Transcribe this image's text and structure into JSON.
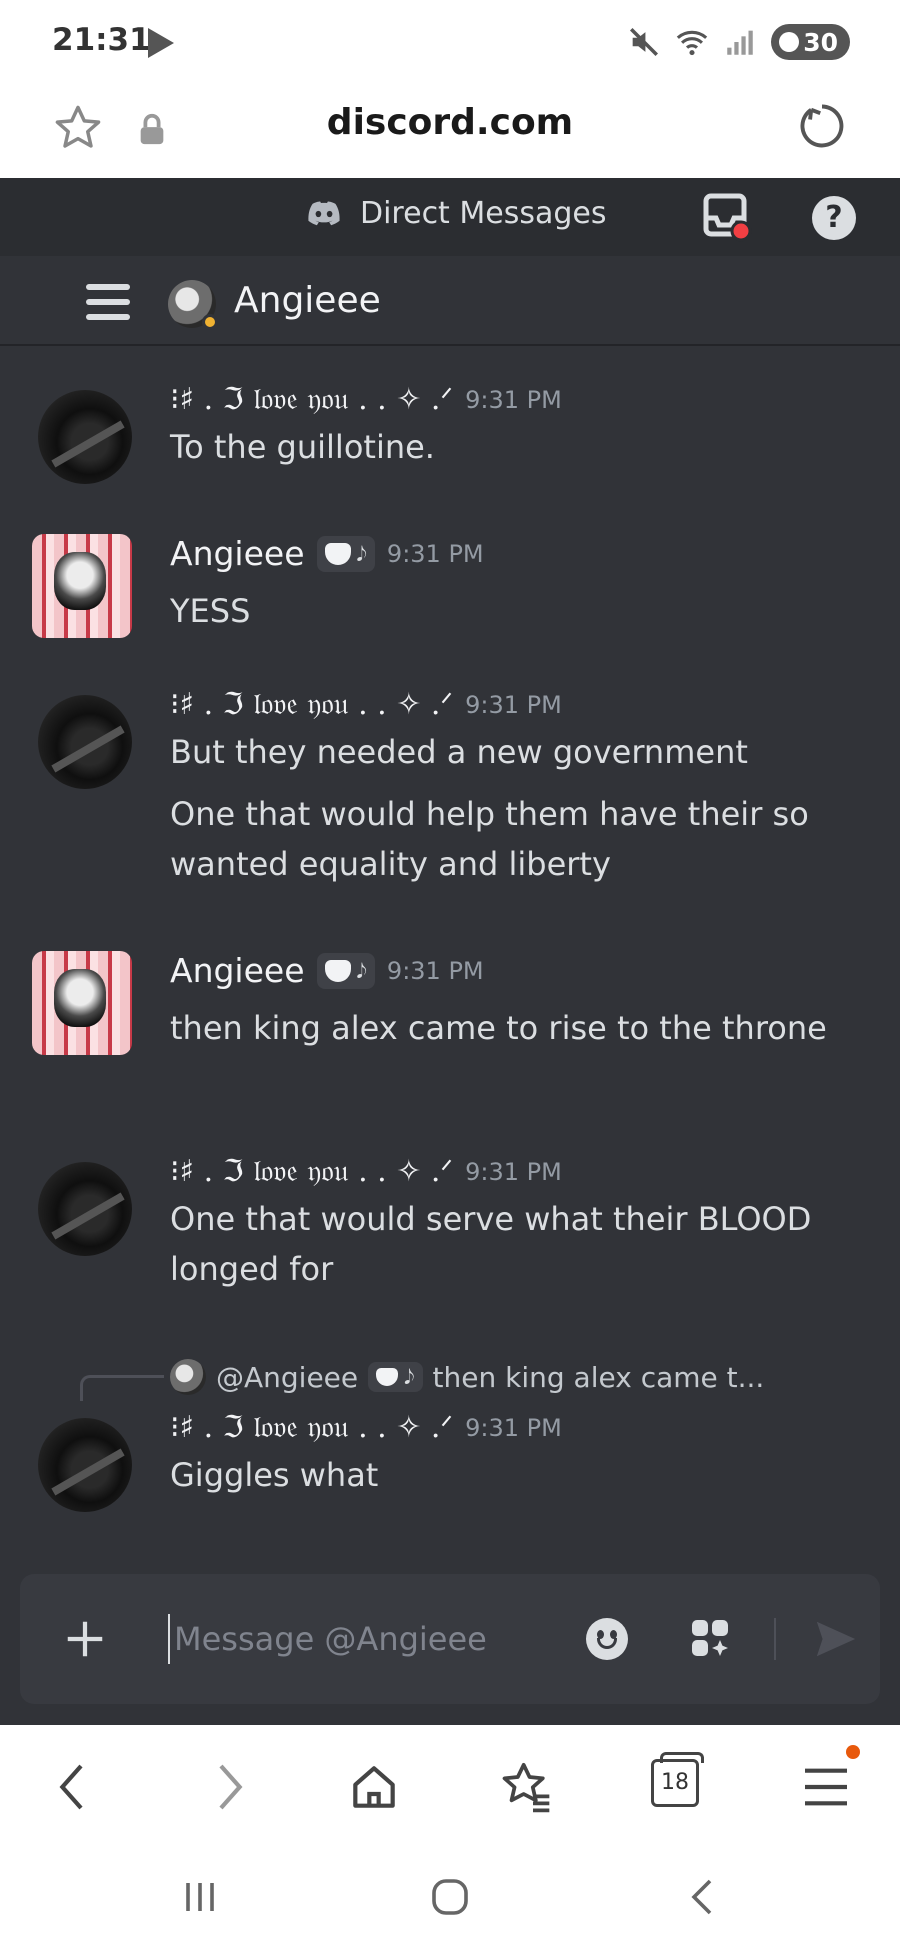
{
  "status_bar": {
    "time": "21:31",
    "battery": "30"
  },
  "browser": {
    "url": "discord.com",
    "tab_count": "18"
  },
  "discord": {
    "header_title": "Direct Messages",
    "help_label": "?",
    "channel_name": "Angieee",
    "composer_placeholder": "Message @Angieee"
  },
  "messages": [
    {
      "author": "⁝♯ . ℑ 𝔩𝔬𝔳𝔢 𝔶𝔬𝔲 .  . ✧ .ᐟ",
      "time": "9:31 PM",
      "text": [
        "To the guillotine."
      ]
    },
    {
      "author": "Angieee",
      "tag": "𝅘𝅥𝅮",
      "time": "9:31 PM",
      "text": [
        "YESS"
      ]
    },
    {
      "author": "⁝♯ . ℑ 𝔩𝔬𝔳𝔢 𝔶𝔬𝔲 .  . ✧ .ᐟ",
      "time": "9:31 PM",
      "text": [
        "But they needed a new government",
        "One that would help them have their so wanted equality and liberty"
      ]
    },
    {
      "author": "Angieee",
      "time": "9:31 PM",
      "text": [
        "then king alex came to rise to the throne"
      ]
    },
    {
      "author": "⁝♯ . ℑ 𝔩𝔬𝔳𝔢 𝔶𝔬𝔲 .  . ✧ .ᐟ",
      "time": "9:31 PM",
      "text": [
        "One that would serve what their BLOOD longed for"
      ]
    },
    {
      "reply_to": {
        "author": "@Angieee",
        "preview": "then king alex came t..."
      },
      "author": "⁝♯ . ℑ 𝔩𝔬𝔳𝔢 𝔶𝔬𝔲 .  . ✧ .ᐟ",
      "time": "9:31 PM",
      "text": [
        "Giggles what"
      ]
    }
  ],
  "colors": {
    "app_bg": "#313338",
    "header_bg": "#2b2d31",
    "composer_bg": "#383a40",
    "timestamp": "#949ba4",
    "notification": "#e8590c"
  }
}
